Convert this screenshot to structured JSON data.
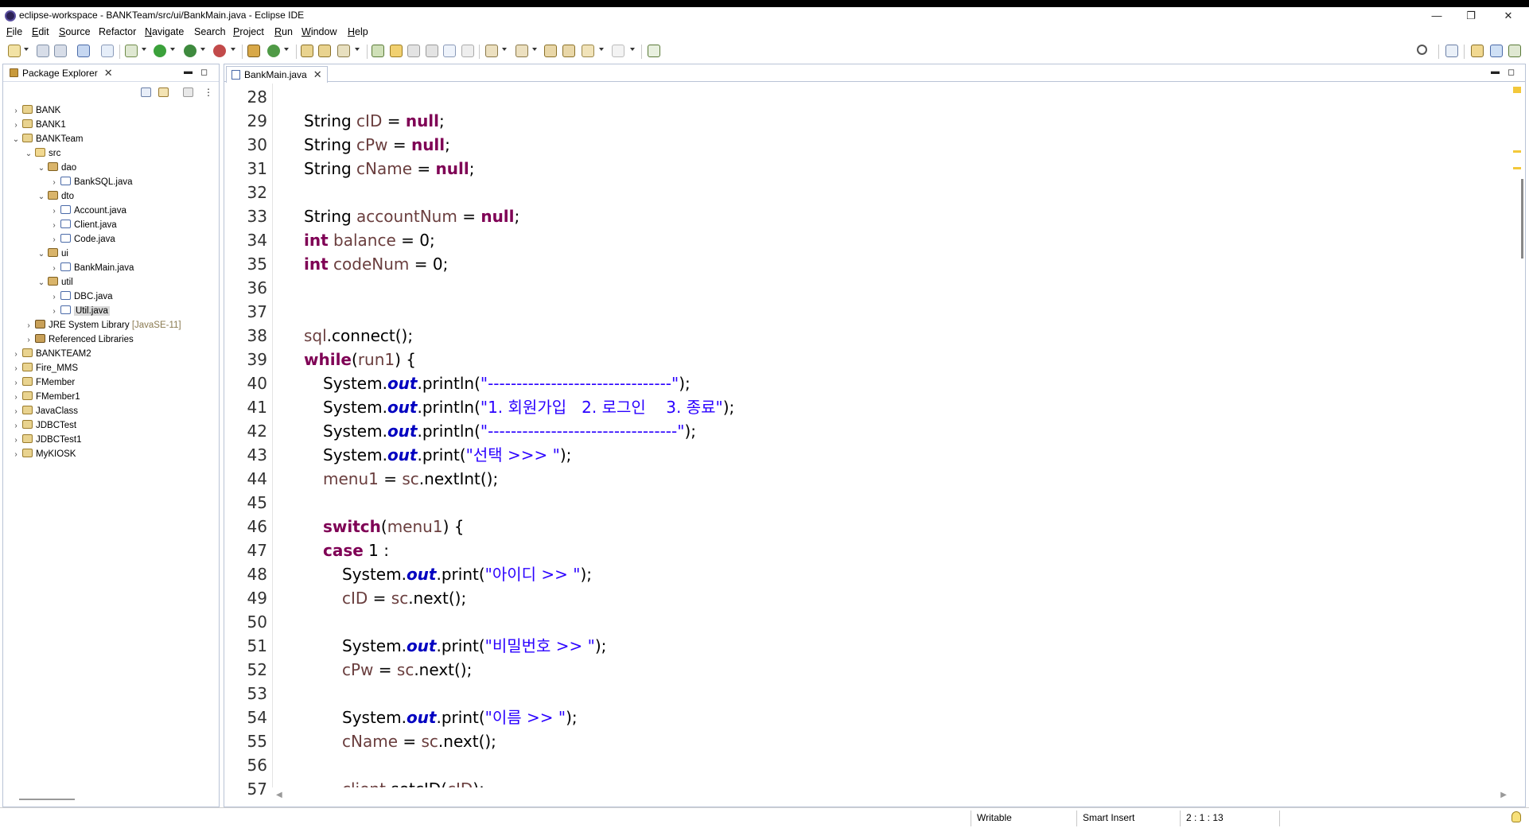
{
  "window": {
    "title": "eclipse-workspace - BANKTeam/src/ui/BankMain.java - Eclipse IDE",
    "minimize": "—",
    "restore": "❐",
    "close": "✕"
  },
  "menu": [
    {
      "label": "File",
      "mnemonic": "F",
      "rest": "ile"
    },
    {
      "label": "Edit",
      "mnemonic": "E",
      "rest": "dit"
    },
    {
      "label": "Source",
      "mnemonic": "S",
      "rest": "ource"
    },
    {
      "label": "Refactor",
      "mnemonic": "",
      "rest": "Refactor"
    },
    {
      "label": "Navigate",
      "mnemonic": "N",
      "rest": "avigate"
    },
    {
      "label": "Search",
      "mnemonic": "",
      "rest": "Search"
    },
    {
      "label": "Project",
      "mnemonic": "P",
      "rest": "roject"
    },
    {
      "label": "Run",
      "mnemonic": "R",
      "rest": "un"
    },
    {
      "label": "Window",
      "mnemonic": "W",
      "rest": "indow"
    },
    {
      "label": "Help",
      "mnemonic": "H",
      "rest": "elp"
    }
  ],
  "package_explorer": {
    "title": "Package Explorer",
    "close": "✕",
    "tree": [
      {
        "label": "BANK",
        "type": "project",
        "expanded": false
      },
      {
        "label": "BANK1",
        "type": "project",
        "expanded": false
      },
      {
        "label": "BANKTeam",
        "type": "project",
        "expanded": true
      },
      {
        "label": "src",
        "type": "src",
        "expanded": true
      },
      {
        "label": "dao",
        "type": "pkg",
        "expanded": true
      },
      {
        "label": "BankSQL.java",
        "type": "java",
        "expanded": false
      },
      {
        "label": "dto",
        "type": "pkg",
        "expanded": true
      },
      {
        "label": "Account.java",
        "type": "java",
        "expanded": false
      },
      {
        "label": "Client.java",
        "type": "java",
        "expanded": false
      },
      {
        "label": "Code.java",
        "type": "java",
        "expanded": false
      },
      {
        "label": "ui",
        "type": "pkg",
        "expanded": true
      },
      {
        "label": "BankMain.java",
        "type": "java",
        "expanded": false
      },
      {
        "label": "util",
        "type": "pkg",
        "expanded": true
      },
      {
        "label": "DBC.java",
        "type": "java",
        "expanded": false
      },
      {
        "label": "Util.java",
        "type": "java",
        "expanded": false,
        "selected": true
      },
      {
        "label": "JRE System Library",
        "suffix": "[JavaSE-11]",
        "type": "lib",
        "expanded": false
      },
      {
        "label": "Referenced Libraries",
        "type": "lib",
        "expanded": false
      },
      {
        "label": "BANKTEAM2",
        "type": "project",
        "expanded": false
      },
      {
        "label": "Fire_MMS",
        "type": "project",
        "expanded": false
      },
      {
        "label": "FMember",
        "type": "project",
        "expanded": false
      },
      {
        "label": "FMember1",
        "type": "project",
        "expanded": false
      },
      {
        "label": "JavaClass",
        "type": "project",
        "expanded": false
      },
      {
        "label": "JDBCTest",
        "type": "project",
        "expanded": false
      },
      {
        "label": "JDBCTest1",
        "type": "project",
        "expanded": false
      },
      {
        "label": "MyKIOSK",
        "type": "project",
        "expanded": false
      }
    ]
  },
  "editor": {
    "tab_label": "BankMain.java",
    "tab_close": "✕",
    "lines": [
      {
        "n": "28",
        "indent": 0,
        "tokens": []
      },
      {
        "n": "29",
        "indent": 2,
        "tokens": [
          {
            "t": "String ",
            "c": ""
          },
          {
            "t": "cID",
            "c": "var"
          },
          {
            "t": " = ",
            "c": ""
          },
          {
            "t": "null",
            "c": "kw"
          },
          {
            "t": ";",
            "c": ""
          }
        ]
      },
      {
        "n": "30",
        "indent": 2,
        "tokens": [
          {
            "t": "String ",
            "c": ""
          },
          {
            "t": "cPw",
            "c": "var"
          },
          {
            "t": " = ",
            "c": ""
          },
          {
            "t": "null",
            "c": "kw"
          },
          {
            "t": ";",
            "c": ""
          }
        ]
      },
      {
        "n": "31",
        "indent": 2,
        "tokens": [
          {
            "t": "String ",
            "c": ""
          },
          {
            "t": "cName",
            "c": "var"
          },
          {
            "t": " = ",
            "c": ""
          },
          {
            "t": "null",
            "c": "kw"
          },
          {
            "t": ";",
            "c": ""
          }
        ]
      },
      {
        "n": "32",
        "indent": 0,
        "tokens": []
      },
      {
        "n": "33",
        "indent": 2,
        "tokens": [
          {
            "t": "String ",
            "c": ""
          },
          {
            "t": "accountNum",
            "c": "var"
          },
          {
            "t": " = ",
            "c": ""
          },
          {
            "t": "null",
            "c": "kw"
          },
          {
            "t": ";",
            "c": ""
          }
        ]
      },
      {
        "n": "34",
        "indent": 2,
        "tokens": [
          {
            "t": "int",
            "c": "kw"
          },
          {
            "t": " ",
            "c": ""
          },
          {
            "t": "balance",
            "c": "var"
          },
          {
            "t": " = 0;",
            "c": ""
          }
        ]
      },
      {
        "n": "35",
        "indent": 2,
        "tokens": [
          {
            "t": "int",
            "c": "kw"
          },
          {
            "t": " ",
            "c": ""
          },
          {
            "t": "codeNum",
            "c": "var"
          },
          {
            "t": " = 0;",
            "c": ""
          }
        ]
      },
      {
        "n": "36",
        "indent": 0,
        "tokens": []
      },
      {
        "n": "37",
        "indent": 0,
        "tokens": []
      },
      {
        "n": "38",
        "indent": 2,
        "tokens": [
          {
            "t": "sql",
            "c": "var"
          },
          {
            "t": ".connect();",
            "c": ""
          }
        ]
      },
      {
        "n": "39",
        "indent": 2,
        "tokens": [
          {
            "t": "while",
            "c": "kw"
          },
          {
            "t": "(",
            "c": ""
          },
          {
            "t": "run1",
            "c": "var"
          },
          {
            "t": ") {",
            "c": ""
          }
        ]
      },
      {
        "n": "40",
        "indent": 3,
        "tokens": [
          {
            "t": "System.",
            "c": ""
          },
          {
            "t": "out",
            "c": "fld"
          },
          {
            "t": ".println(",
            "c": ""
          },
          {
            "t": "\"--------------------------------\"",
            "c": "str"
          },
          {
            "t": ");",
            "c": ""
          }
        ]
      },
      {
        "n": "41",
        "indent": 3,
        "tokens": [
          {
            "t": "System.",
            "c": ""
          },
          {
            "t": "out",
            "c": "fld"
          },
          {
            "t": ".println(",
            "c": ""
          },
          {
            "t": "\"1. 회원가입   2. 로그인    3. 종료\"",
            "c": "str"
          },
          {
            "t": ");",
            "c": ""
          }
        ]
      },
      {
        "n": "42",
        "indent": 3,
        "tokens": [
          {
            "t": "System.",
            "c": ""
          },
          {
            "t": "out",
            "c": "fld"
          },
          {
            "t": ".println(",
            "c": ""
          },
          {
            "t": "\"---------------------------------\"",
            "c": "str"
          },
          {
            "t": ");",
            "c": ""
          }
        ]
      },
      {
        "n": "43",
        "indent": 3,
        "tokens": [
          {
            "t": "System.",
            "c": ""
          },
          {
            "t": "out",
            "c": "fld"
          },
          {
            "t": ".print(",
            "c": ""
          },
          {
            "t": "\"선택 >>> \"",
            "c": "str"
          },
          {
            "t": ");",
            "c": ""
          }
        ]
      },
      {
        "n": "44",
        "indent": 3,
        "tokens": [
          {
            "t": "menu1",
            "c": "var"
          },
          {
            "t": " = ",
            "c": ""
          },
          {
            "t": "sc",
            "c": "var"
          },
          {
            "t": ".nextInt();",
            "c": ""
          }
        ]
      },
      {
        "n": "45",
        "indent": 0,
        "tokens": []
      },
      {
        "n": "46",
        "indent": 3,
        "tokens": [
          {
            "t": "switch",
            "c": "kw"
          },
          {
            "t": "(",
            "c": ""
          },
          {
            "t": "menu1",
            "c": "var"
          },
          {
            "t": ") {",
            "c": ""
          }
        ]
      },
      {
        "n": "47",
        "indent": 3,
        "tokens": [
          {
            "t": "case",
            "c": "kw"
          },
          {
            "t": " 1 :",
            "c": ""
          }
        ]
      },
      {
        "n": "48",
        "indent": 4,
        "tokens": [
          {
            "t": "System.",
            "c": ""
          },
          {
            "t": "out",
            "c": "fld"
          },
          {
            "t": ".print(",
            "c": ""
          },
          {
            "t": "\"아이디 >> \"",
            "c": "str"
          },
          {
            "t": ");",
            "c": ""
          }
        ]
      },
      {
        "n": "49",
        "indent": 4,
        "tokens": [
          {
            "t": "cID",
            "c": "var"
          },
          {
            "t": " = ",
            "c": ""
          },
          {
            "t": "sc",
            "c": "var"
          },
          {
            "t": ".next();",
            "c": ""
          }
        ]
      },
      {
        "n": "50",
        "indent": 0,
        "tokens": []
      },
      {
        "n": "51",
        "indent": 4,
        "tokens": [
          {
            "t": "System.",
            "c": ""
          },
          {
            "t": "out",
            "c": "fld"
          },
          {
            "t": ".print(",
            "c": ""
          },
          {
            "t": "\"비밀번호 >> \"",
            "c": "str"
          },
          {
            "t": ");",
            "c": ""
          }
        ]
      },
      {
        "n": "52",
        "indent": 4,
        "tokens": [
          {
            "t": "cPw",
            "c": "var"
          },
          {
            "t": " = ",
            "c": ""
          },
          {
            "t": "sc",
            "c": "var"
          },
          {
            "t": ".next();",
            "c": ""
          }
        ]
      },
      {
        "n": "53",
        "indent": 0,
        "tokens": []
      },
      {
        "n": "54",
        "indent": 4,
        "tokens": [
          {
            "t": "System.",
            "c": ""
          },
          {
            "t": "out",
            "c": "fld"
          },
          {
            "t": ".print(",
            "c": ""
          },
          {
            "t": "\"이름 >> \"",
            "c": "str"
          },
          {
            "t": ");",
            "c": ""
          }
        ]
      },
      {
        "n": "55",
        "indent": 4,
        "tokens": [
          {
            "t": "cName",
            "c": "var"
          },
          {
            "t": " = ",
            "c": ""
          },
          {
            "t": "sc",
            "c": "var"
          },
          {
            "t": ".next();",
            "c": ""
          }
        ]
      },
      {
        "n": "56",
        "indent": 0,
        "tokens": []
      },
      {
        "n": "57",
        "indent": 4,
        "tokens": [
          {
            "t": "client",
            "c": "var"
          },
          {
            "t": ".setcID(",
            "c": ""
          },
          {
            "t": "cID",
            "c": "var"
          },
          {
            "t": ");",
            "c": ""
          }
        ]
      }
    ]
  },
  "status": {
    "writable": "Writable",
    "insert_mode": "Smart Insert",
    "position": "2 : 1 : 13"
  },
  "colors": {
    "keyword": "#7f0055",
    "string": "#2a00ff",
    "field": "#0000c0",
    "variable": "#6a3e3e",
    "panel_border": "#b9c3d6"
  },
  "icons": {
    "search": "search-icon",
    "perspective_open": "open-perspective-icon",
    "java_perspective": "java-perspective-icon",
    "debug_perspective": "debug-perspective-icon",
    "lightbulb": "lightbulb-icon"
  }
}
